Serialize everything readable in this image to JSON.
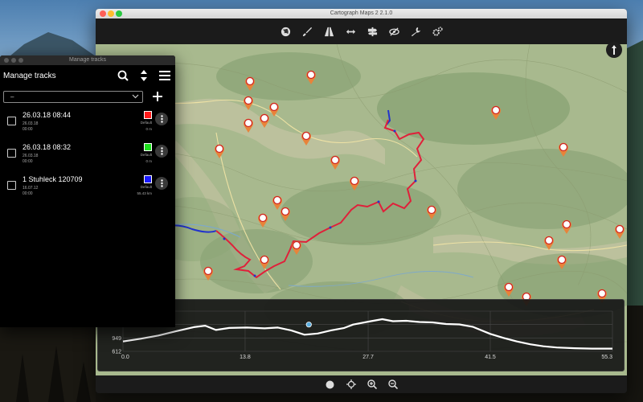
{
  "main_window": {
    "title": "Cartograph Maps 2 2.1.0",
    "toolbar_icons": [
      "globe-icon",
      "brush-icon",
      "road-icon",
      "width-arrows-icon",
      "signpost-icon",
      "eye-slash-icon",
      "wrench-icon",
      "gears-icon"
    ],
    "bottom_icons": [
      "record-dot-icon",
      "locate-crosshair-icon",
      "zoom-in-icon",
      "zoom-out-icon"
    ]
  },
  "elevation_profile": {
    "y_ticks": [
      "1286",
      "949",
      "612"
    ],
    "x_ticks": [
      "0.0",
      "13.8",
      "27.7",
      "41.5",
      "55.3"
    ],
    "x_range": [
      0,
      55.3
    ],
    "y_range": [
      612,
      1623
    ],
    "profile": [
      [
        0.0,
        860
      ],
      [
        2,
        930
      ],
      [
        4,
        1010
      ],
      [
        6,
        1120
      ],
      [
        8,
        1220
      ],
      [
        9.3,
        1258
      ],
      [
        10.5,
        1150
      ],
      [
        12,
        1200
      ],
      [
        14,
        1210
      ],
      [
        16,
        1190
      ],
      [
        17.5,
        1210
      ],
      [
        19,
        1140
      ],
      [
        20.5,
        1030
      ],
      [
        22,
        1060
      ],
      [
        23.5,
        1140
      ],
      [
        25,
        1200
      ],
      [
        26,
        1286
      ],
      [
        28,
        1370
      ],
      [
        29.3,
        1420
      ],
      [
        30.5,
        1370
      ],
      [
        32,
        1380
      ],
      [
        33.5,
        1350
      ],
      [
        35,
        1340
      ],
      [
        36.5,
        1300
      ],
      [
        38,
        1290
      ],
      [
        39.5,
        1230
      ],
      [
        41.5,
        1050
      ],
      [
        43,
        950
      ],
      [
        44.5,
        860
      ],
      [
        46,
        790
      ],
      [
        47.5,
        740
      ],
      [
        49,
        710
      ],
      [
        51,
        690
      ],
      [
        53,
        680
      ],
      [
        55.3,
        680
      ]
    ],
    "marker": [
      21,
      1286
    ],
    "line_color": "#ffffff",
    "marker_color": "#5aaee0"
  },
  "manage_tracks": {
    "window_title": "Manage tracks",
    "title": "Manage tracks",
    "filter_value": "–",
    "tracks": [
      {
        "name": "26.03.18 08:44",
        "date": "26.03.18",
        "time": "00:00",
        "style": "Default",
        "distance": "0 m",
        "color": "#ff1a1a"
      },
      {
        "name": "26.03.18 08:32",
        "date": "26.03.18",
        "time": "00:00",
        "style": "Default",
        "distance": "0 m",
        "color": "#1ee01e"
      },
      {
        "name": "1 Stuhleck 120709",
        "date": "16.07.12",
        "time": "00:00",
        "style": "Default",
        "distance": "55.43 km",
        "color": "#1a1aff"
      }
    ]
  },
  "colors": {
    "track_red": "#e0203a",
    "track_blue": "#2233cc",
    "poi_orange": "#e8833a"
  }
}
